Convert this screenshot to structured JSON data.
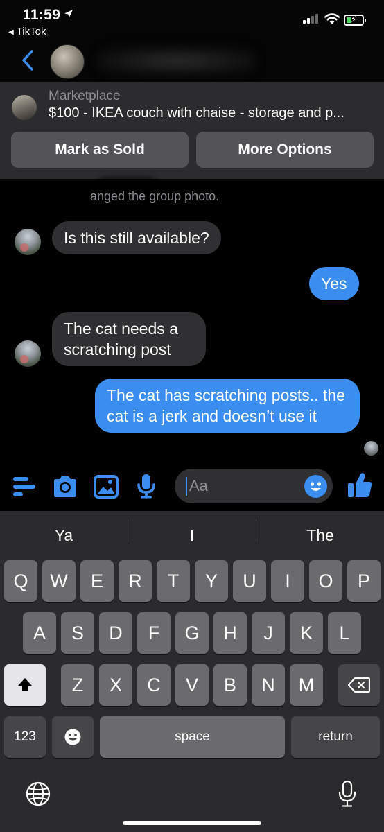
{
  "status_bar": {
    "time": "11:59",
    "back_app": "TikTok",
    "location_icon": "location-arrow-icon",
    "signal_icon": "cellular-signal-icon",
    "wifi_icon": "wifi-icon",
    "battery_icon": "battery-charging-icon",
    "battery_level": 0.25,
    "battery_color": "#4cd964"
  },
  "header": {
    "back_icon": "chevron-left-icon",
    "accent": "#3b8ef0"
  },
  "marketplace": {
    "label": "Marketplace",
    "listing_title": "$100 - IKEA couch with chaise - storage and p...",
    "mark_sold_label": "Mark as Sold",
    "more_options_label": "More Options"
  },
  "conversation": {
    "system_message": "anged the group photo.",
    "messages": [
      {
        "from": "them",
        "text": "Is this still available?"
      },
      {
        "from": "me",
        "text": "Yes"
      },
      {
        "from": "them",
        "text": "The cat needs a scratching post"
      },
      {
        "from": "me",
        "text": "The cat has scratching posts.. the cat is a jerk and doesn’t use it"
      }
    ],
    "incoming_bubble_color": "#303032",
    "outgoing_bubble_color": "#3b8ef0"
  },
  "composer": {
    "placeholder": "Aa",
    "icons": [
      "menu-icon",
      "camera-icon",
      "gallery-icon",
      "microphone-icon",
      "emoji-icon",
      "thumbs-up-icon"
    ]
  },
  "keyboard": {
    "suggestions": [
      "Ya",
      "I",
      "The"
    ],
    "row1": [
      "Q",
      "W",
      "E",
      "R",
      "T",
      "Y",
      "U",
      "I",
      "O",
      "P"
    ],
    "row2": [
      "A",
      "S",
      "D",
      "F",
      "G",
      "H",
      "J",
      "K",
      "L"
    ],
    "row3": [
      "Z",
      "X",
      "C",
      "V",
      "B",
      "N",
      "M"
    ],
    "numbers_label": "123",
    "space_label": "space",
    "return_label": "return",
    "shift_icon": "shift-icon",
    "delete_icon": "backspace-icon",
    "emoji_key_icon": "emoji-keyboard-icon",
    "globe_icon": "globe-icon",
    "dictation_icon": "dictation-microphone-icon"
  }
}
